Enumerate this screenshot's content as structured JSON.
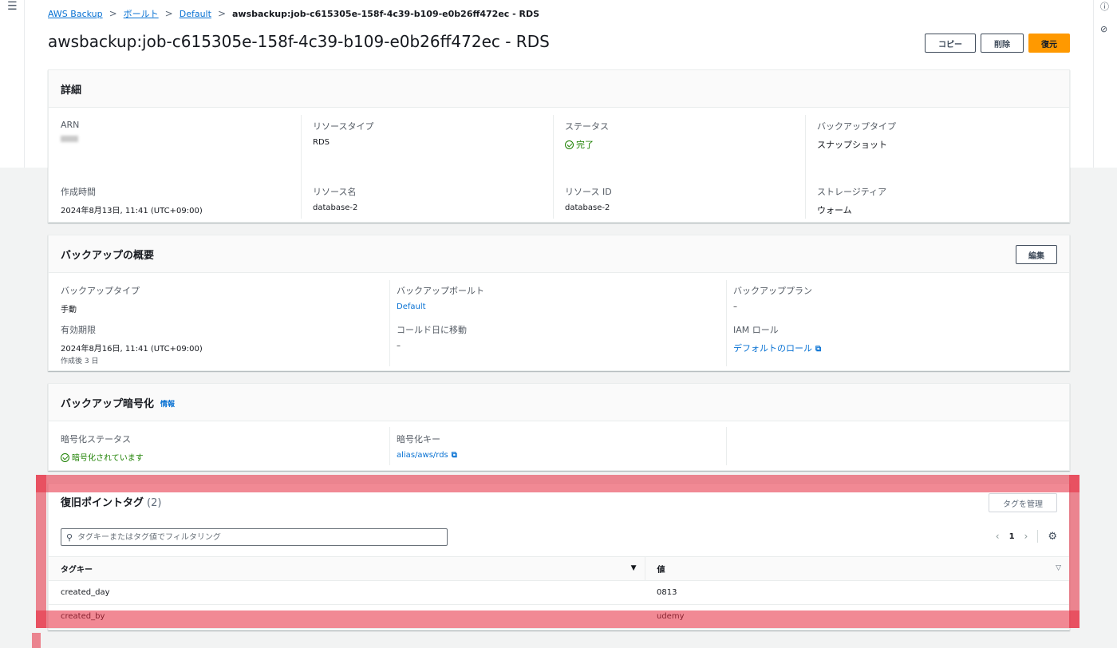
{
  "breadcrumb": {
    "items": [
      "AWS Backup",
      "ボールト",
      "Default"
    ],
    "current": "awsbackup:job-c615305e-158f-4c39-b109-e0b26ff472ec - RDS"
  },
  "page_title": "awsbackup:job-c615305e-158f-4c39-b109-e0b26ff472ec - RDS",
  "actions": {
    "copy": "コピー",
    "delete": "削除",
    "restore": "復元"
  },
  "details": {
    "title": "詳細",
    "arn_label": "ARN",
    "resource_type_label": "リソースタイプ",
    "resource_type": "RDS",
    "status_label": "ステータス",
    "status": "完了",
    "backup_type_label": "バックアップタイプ",
    "backup_type": "スナップショット",
    "created_label": "作成時間",
    "created": "2024年8月13日, 11:41 (UTC+09:00)",
    "resource_name_label": "リソース名",
    "resource_name": "database-2",
    "resource_id_label": "リソース ID",
    "resource_id": "database-2",
    "storage_tier_label": "ストレージティア",
    "storage_tier": "ウォーム"
  },
  "overview": {
    "title": "バックアップの概要",
    "edit": "編集",
    "backup_type_label": "バックアップタイプ",
    "backup_type": "手動",
    "vault_label": "バックアップボールト",
    "vault": "Default",
    "plan_label": "バックアッププラン",
    "plan": "–",
    "expiry_label": "有効期限",
    "expiry": "2024年8月16日, 11:41 (UTC+09:00)",
    "expiry_sub": "作成後 3 日",
    "cold_label": "コールド日に移動",
    "cold": "–",
    "iam_label": "IAM ロール",
    "iam": "デフォルトのロール"
  },
  "encryption": {
    "title": "バックアップ暗号化",
    "info": "情報",
    "status_label": "暗号化ステータス",
    "status": "暗号化されています",
    "key_label": "暗号化キー",
    "key": "alias/aws/rds"
  },
  "tags": {
    "title": "復旧ポイントタグ",
    "count": "(2)",
    "manage": "タグを管理",
    "search_placeholder": "タグキーまたはタグ値でフィルタリング",
    "page": "1",
    "columns": [
      "タグキー",
      "値"
    ],
    "rows": [
      {
        "key": "created_day",
        "value": "0813"
      },
      {
        "key": "created_by",
        "value": "udemy"
      }
    ]
  },
  "colors": {
    "primary": "#ff9900",
    "link": "#0972d3",
    "success": "#1d8102",
    "highlight": "#e6283c"
  }
}
